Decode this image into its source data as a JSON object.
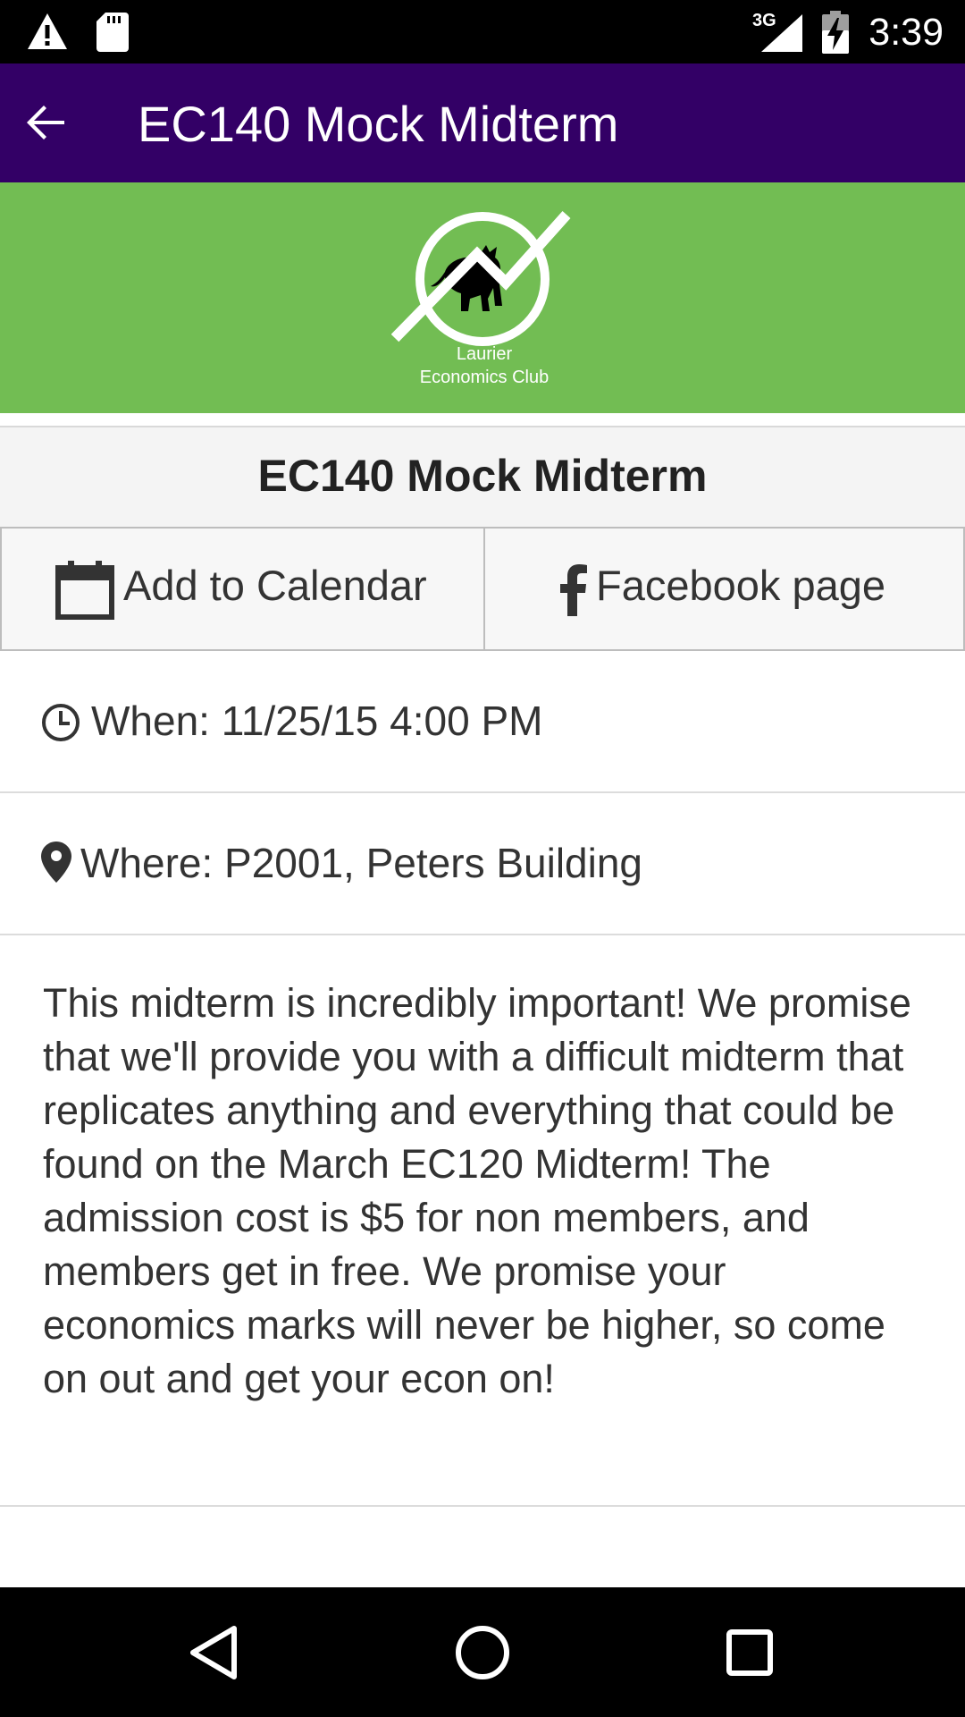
{
  "status_bar": {
    "network": "3G",
    "time": "3:39"
  },
  "app_bar": {
    "title": "EC140 Mock Midterm",
    "back_icon": "arrow-back-icon"
  },
  "banner": {
    "logo_text_line1": "Laurier",
    "logo_text_line2": "Economics Club",
    "background_color": "#72bd53"
  },
  "event": {
    "title": "EC140 Mock Midterm",
    "actions": {
      "calendar_label": "Add to Calendar",
      "facebook_label": "Facebook page"
    },
    "when": "When: 11/25/15 4:00 PM",
    "where": "Where: P2001, Peters Building",
    "description": "This midterm is incredibly important! We promise that we'll provide you with a difficult midterm that replicates anything and everything that could be found on the March EC120 Midterm! The admission cost is $5 for non members, and members get in free. We promise your economics marks will never be higher, so come on out and get your econ on!"
  },
  "colors": {
    "app_bar": "#330066",
    "banner": "#72bd53"
  }
}
